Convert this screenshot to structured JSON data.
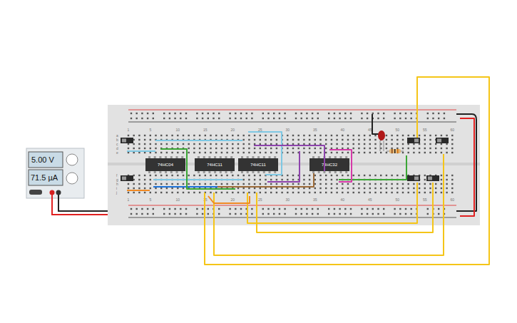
{
  "power_supply": {
    "voltage": "5.00 V",
    "current": "71.5 µA"
  },
  "chips": [
    {
      "label": "74HC04"
    },
    {
      "label": "74HC11"
    },
    {
      "label": "74HC11"
    },
    {
      "label": "74HC32"
    }
  ],
  "breadboard": {
    "column_numbers": [
      "1",
      "5",
      "10",
      "15",
      "20",
      "25",
      "30",
      "35",
      "40",
      "45",
      "50",
      "55",
      "60"
    ],
    "row_letters_top": [
      "a",
      "b",
      "c",
      "d",
      "e"
    ],
    "row_letters_bottom": [
      "f",
      "g",
      "h",
      "i",
      "j"
    ]
  },
  "led": {
    "lit": false
  },
  "switches": [
    {
      "on": false
    },
    {
      "on": false
    },
    {
      "on": true
    },
    {
      "on": false
    },
    {
      "on": true
    },
    {
      "on": false
    }
  ]
}
